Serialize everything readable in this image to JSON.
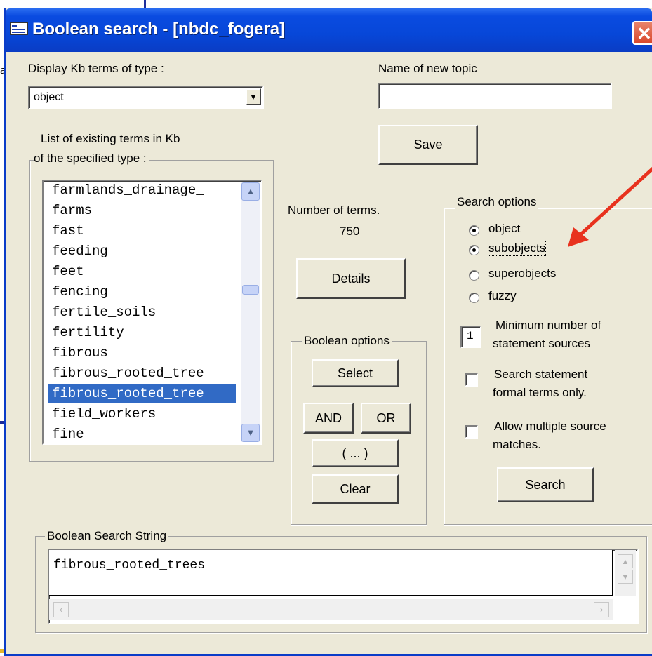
{
  "window": {
    "title": "Boolean search - [nbdc_fogera]",
    "close_glyph": "✕",
    "background_fragment": "a"
  },
  "type_selector": {
    "label": "Display Kb terms of type :",
    "selected": "object"
  },
  "new_topic": {
    "label": "Name of new topic",
    "value": "",
    "save_label": "Save"
  },
  "term_list": {
    "label_line1": "List of existing terms in Kb",
    "label_line2": "of the specified type :",
    "items": [
      {
        "label": "farmlands_drainage_",
        "selected": false
      },
      {
        "label": "farms",
        "selected": false
      },
      {
        "label": "fast",
        "selected": false
      },
      {
        "label": "feeding",
        "selected": false
      },
      {
        "label": "feet",
        "selected": false
      },
      {
        "label": "fencing",
        "selected": false
      },
      {
        "label": "fertile_soils",
        "selected": false
      },
      {
        "label": "fertility",
        "selected": false
      },
      {
        "label": "fibrous",
        "selected": false
      },
      {
        "label": "fibrous_rooted_tree",
        "selected": false
      },
      {
        "label": "fibrous_rooted_tree",
        "selected": true
      },
      {
        "label": "field_workers",
        "selected": false
      },
      {
        "label": "fine",
        "selected": false
      }
    ]
  },
  "term_count": {
    "label": "Number of terms.",
    "value": "750",
    "details_label": "Details"
  },
  "boolean_options": {
    "title": "Boolean options",
    "select_label": "Select",
    "and_label": "AND",
    "or_label": "OR",
    "paren_label": "( ... )",
    "clear_label": "Clear"
  },
  "search_options": {
    "title": "Search options",
    "radios": [
      {
        "label": "object",
        "checked": true
      },
      {
        "label": "subobjects",
        "checked": true
      },
      {
        "label": "superobjects",
        "checked": false
      },
      {
        "label": "fuzzy",
        "checked": false
      }
    ],
    "min_sources": {
      "value": "1",
      "label_line1": "Minimum number of",
      "label_line2": "statement sources"
    },
    "formal_terms": {
      "label_line1": "Search statement",
      "label_line2": "formal terms only.",
      "checked": false
    },
    "multiple_sources": {
      "label_line1": "Allow multiple source",
      "label_line2": "matches.",
      "checked": false
    },
    "search_label": "Search"
  },
  "search_string": {
    "title": "Boolean Search String",
    "value": "fibrous_rooted_trees"
  },
  "colors": {
    "titlebar": "#0747d8",
    "dialog_bg": "#ece9d8",
    "selection": "#316ac5",
    "annotation_arrow": "#e8321e"
  },
  "icons": {
    "close": "close-icon",
    "dropdown": "chevron-down-icon",
    "scroll_up": "chevron-up-icon",
    "scroll_down": "chevron-down-icon",
    "annotation": "red-arrow-icon"
  }
}
